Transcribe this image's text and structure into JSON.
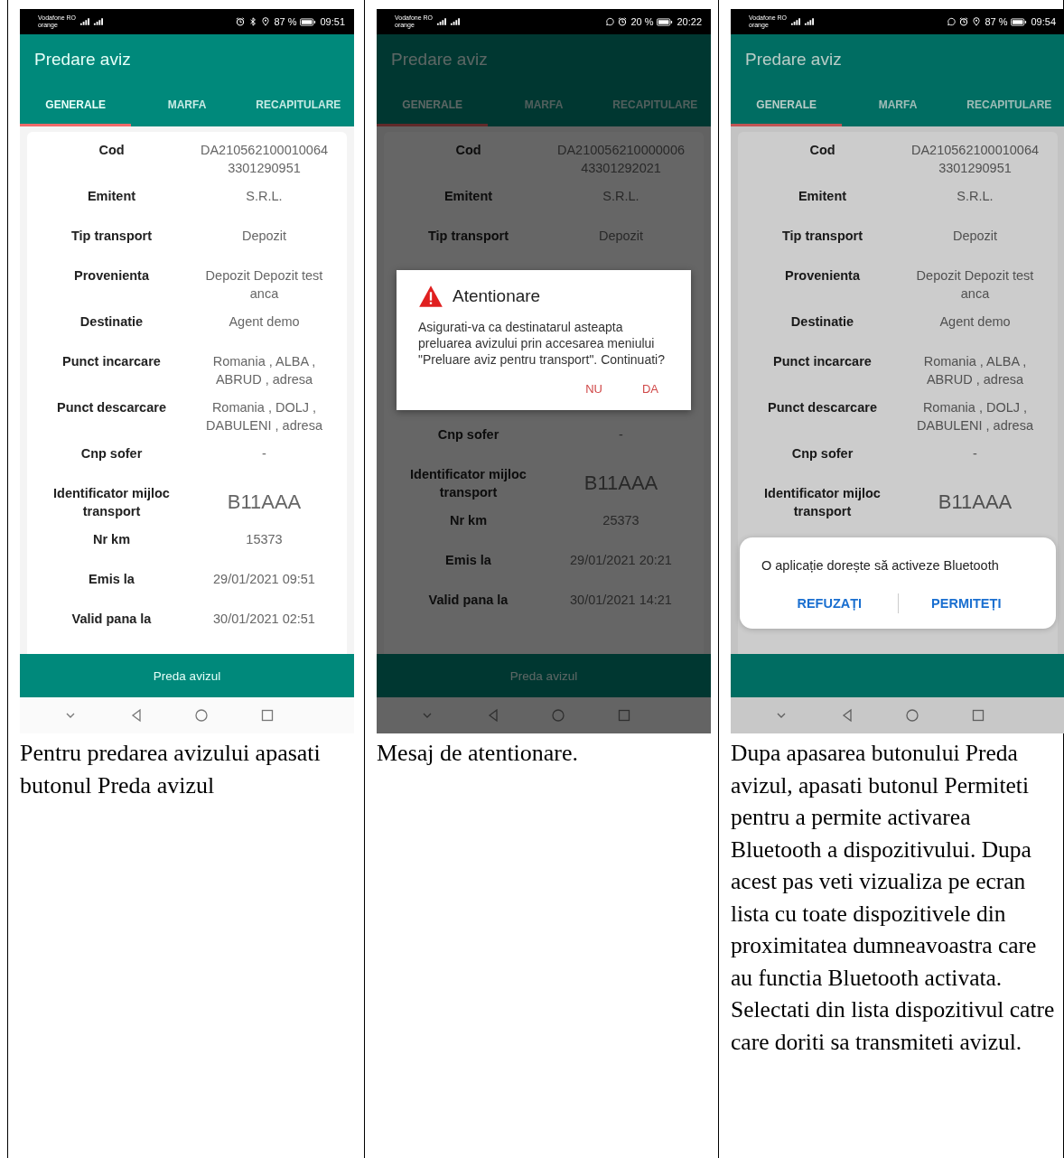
{
  "columns": [
    {
      "phone": {
        "status_bar": {
          "carrier": "Vodafone RO",
          "carrier_2": "orange",
          "icons": [
            {
              "kind": "alarm"
            },
            {
              "kind": "bluetooth"
            },
            {
              "kind": "location"
            }
          ],
          "battery": "87 %",
          "time": "09:51"
        },
        "title": "Predare aviz",
        "tabs": [
          {
            "label": "GENERALE",
            "selected": true
          },
          {
            "label": "MARFA",
            "selected": false
          },
          {
            "label": "RECAPITULARE",
            "selected": false
          }
        ],
        "items": [
          {
            "kind": "field",
            "label": "Cod",
            "value": "DA210562100010064 3301290951"
          },
          {
            "kind": "field",
            "label": "Emitent",
            "value": "S.R.L."
          },
          {
            "kind": "field",
            "label": "Tip transport",
            "value": "Depozit"
          },
          {
            "kind": "field",
            "label": "Provenienta",
            "value": "Depozit Depozit test anca"
          },
          {
            "kind": "field",
            "label": "Destinatie",
            "value": "Agent demo"
          },
          {
            "kind": "field",
            "label": "Punct incarcare",
            "value": "Romania , ALBA , ABRUD , adresa"
          },
          {
            "kind": "field",
            "label": "Punct descarcare",
            "value": "Romania , DOLJ , DABULENI , adresa"
          },
          {
            "kind": "field",
            "label": "Cnp sofer",
            "value": "-"
          },
          {
            "kind": "plate",
            "label": "Identificator mijloc transport",
            "value": "B11AAA"
          },
          {
            "kind": "field",
            "label": "Nr km",
            "value": "15373"
          },
          {
            "kind": "field",
            "label": "Emis la",
            "value": "29/01/2021 09:51"
          },
          {
            "kind": "field",
            "label": "Valid pana la",
            "value": "30/01/2021 02:51"
          }
        ],
        "button": "Preda avizul"
      },
      "caption": "Pentru predarea avizului apasati butonul Preda avizul"
    },
    {
      "phone": {
        "status_bar": {
          "carrier": "Vodafone RO",
          "carrier_2": "orange",
          "icons": [
            {
              "kind": "whatsapp"
            },
            {
              "kind": "alarm"
            }
          ],
          "battery": "20 %",
          "time": "20:22"
        },
        "title": "Predare aviz",
        "tabs": [
          {
            "label": "GENERALE",
            "selected": true
          },
          {
            "label": "MARFA",
            "selected": false
          },
          {
            "label": "RECAPITULARE",
            "selected": false
          }
        ],
        "scrim": {
          "kind": "dark"
        },
        "items": [
          {
            "kind": "field",
            "label": "Cod",
            "value": "DA210056210000006 43301292021"
          },
          {
            "kind": "field",
            "label": "Emitent",
            "value": "S.R.L."
          },
          {
            "kind": "field",
            "label": "Tip transport",
            "value": "Depozit"
          },
          {
            "kind": "alert",
            "title": "Atentionare",
            "message": "Asigurati-va ca destinatarul asteapta preluarea avizului prin accesarea meniului \"Preluare aviz pentru transport\". Continuati?",
            "actions": [
              "NU",
              "DA"
            ]
          },
          {
            "kind": "field",
            "label": "Cnp sofer",
            "value": "-"
          },
          {
            "kind": "plate",
            "label": "Identificator mijloc transport",
            "value": "B11AAA"
          },
          {
            "kind": "field",
            "label": "Nr km",
            "value": "25373"
          },
          {
            "kind": "field",
            "label": "Emis la",
            "value": "29/01/2021 20:21"
          },
          {
            "kind": "field",
            "label": "Valid pana la",
            "value": "30/01/2021 14:21"
          }
        ],
        "button": "Preda avizul"
      },
      "caption": "Mesaj de atentionare."
    },
    {
      "phone": {
        "status_bar": {
          "carrier": "Vodafone RO",
          "carrier_2": "orange",
          "icons": [
            {
              "kind": "whatsapp"
            },
            {
              "kind": "alarm"
            },
            {
              "kind": "location"
            }
          ],
          "battery": "87 %",
          "time": "09:54"
        },
        "title": "Predare aviz",
        "tabs": [
          {
            "label": "GENERALE",
            "selected": true
          },
          {
            "label": "MARFA",
            "selected": false
          },
          {
            "label": "RECAPITULARE",
            "selected": false
          }
        ],
        "scrim": {
          "kind": "light"
        },
        "items": [
          {
            "kind": "field",
            "label": "Cod",
            "value": "DA210562100010064 3301290951"
          },
          {
            "kind": "field",
            "label": "Emitent",
            "value": "S.R.L."
          },
          {
            "kind": "field",
            "label": "Tip transport",
            "value": "Depozit"
          },
          {
            "kind": "field",
            "label": "Provenienta",
            "value": "Depozit Depozit test anca"
          },
          {
            "kind": "field",
            "label": "Destinatie",
            "value": "Agent demo"
          },
          {
            "kind": "field",
            "label": "Punct incarcare",
            "value": "Romania , ALBA , ABRUD , adresa"
          },
          {
            "kind": "field",
            "label": "Punct descarcare",
            "value": "Romania , DOLJ , DABULENI , adresa"
          },
          {
            "kind": "field",
            "label": "Cnp sofer",
            "value": "-"
          },
          {
            "kind": "plate",
            "label": "Identificator mijloc transport",
            "value": "B11AAA"
          },
          {
            "kind": "permission",
            "message": "O aplicație dorește să activeze Bluetooth",
            "actions": [
              "REFUZAȚI",
              "PERMITEȚI"
            ]
          }
        ]
      },
      "caption": "Dupa apasarea butonului Preda avizul, apasati butonul Permiteti pentru a permite activarea Bluetooth a dispozitivului. Dupa acest pas veti vizualiza pe ecran lista cu toate dispozitivele din proximitatea dumneavoastra care au functia Bluetooth activata. Selectati din lista dispozitivul catre care doriti sa transmiteti avizul."
    }
  ]
}
